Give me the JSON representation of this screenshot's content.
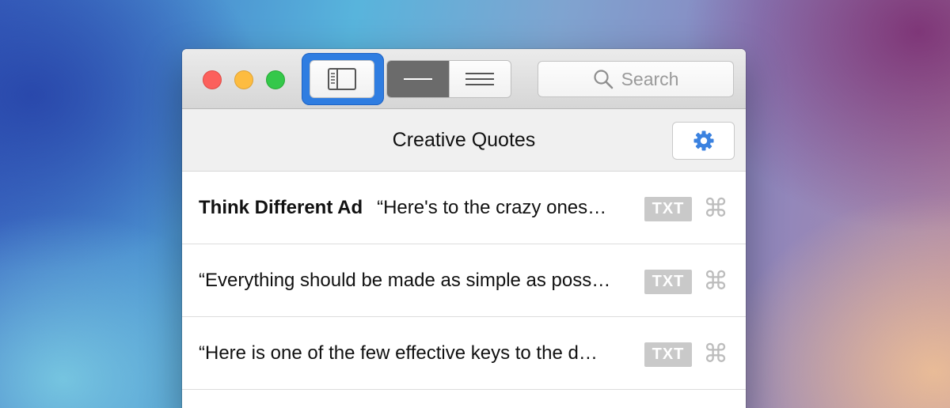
{
  "window": {
    "title": "Creative Quotes"
  },
  "toolbar": {
    "sidebar_toggle_icon": "sidebar-icon",
    "view_single_icon": "single-line-icon",
    "view_list_icon": "multi-line-icon",
    "search": {
      "placeholder": "Search",
      "icon": "search-icon"
    }
  },
  "header": {
    "title": "Creative Quotes",
    "settings_icon": "gear-icon"
  },
  "rows": [
    {
      "title": "Think Different Ad",
      "quote": "“Here's to the crazy ones…",
      "type": "TXT"
    },
    {
      "title": "",
      "quote": "“Everything should be made as simple as poss…",
      "type": "TXT"
    },
    {
      "title": "",
      "quote": "“Here is one of the few effective keys to the d…",
      "type": "TXT"
    }
  ],
  "colors": {
    "accent": "#2f7de1",
    "gear": "#3b82e0",
    "badge": "#c9c9c9"
  }
}
